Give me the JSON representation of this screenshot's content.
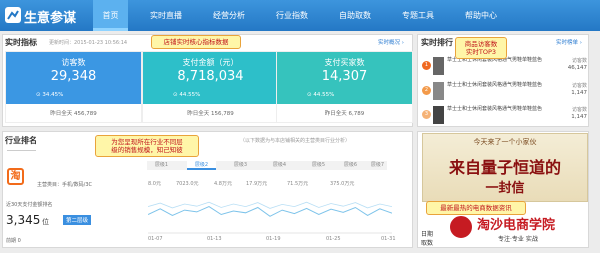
{
  "app": {
    "brand": "生意参谋"
  },
  "nav": {
    "items": [
      "首页",
      "实时直播",
      "经营分析",
      "行业指数",
      "自助取数",
      "专题工具",
      "帮助中心"
    ],
    "active_index": 0
  },
  "realtime": {
    "title": "实时指标",
    "update_time": "更新时间：2015-01-23 10:56:14",
    "link": "实时概况 ›",
    "cards": [
      {
        "label": "访客数",
        "value": "29,348",
        "change": "34.45%",
        "yesterday_label": "昨日全天",
        "yesterday_value": "456,789",
        "color": "#3b97e3"
      },
      {
        "label": "支付金额（元）",
        "value": "8,718,034",
        "change": "44.55%",
        "yesterday_label": "昨日全天",
        "yesterday_value": "156,789",
        "color": "#2dbfc9"
      },
      {
        "label": "支付买家数",
        "value": "14,307",
        "change": "44.55%",
        "yesterday_label": "昨日全天",
        "yesterday_value": "6,789",
        "color": "#36c3bd"
      }
    ]
  },
  "rank": {
    "title": "实时排行",
    "link": "实时榜单 ›",
    "items": [
      {
        "num": "1",
        "name": "草士士和士休闲套装风格通气男鞋单鞋蓝色",
        "unit": "访客数",
        "value": "46,147"
      },
      {
        "num": "2",
        "name": "草士士和士休闲套装风格通气男鞋单鞋蓝色",
        "unit": "访客数",
        "value": "1,147"
      },
      {
        "num": "3",
        "name": "草士士和士休闲套装风格通气男鞋单鞋蓝色",
        "unit": "访客数",
        "value": "1,147"
      }
    ]
  },
  "industry": {
    "title": "行业排名",
    "hint": "（以下数据为与本店铺相关的主营类目行业分析）",
    "shop_icon": "淘",
    "main_category": "主营类目：手机/数码/3C",
    "rank_label": "近30天支付金额排名",
    "rank_value": "3,345",
    "rank_unit": "位",
    "tier_badge": "第二层级",
    "prev_label": "前期 0",
    "tabs": [
      "层级1",
      "层级2",
      "层级3",
      "层级4",
      "层级5",
      "层级6",
      "层级7"
    ],
    "scales": [
      "8.0元",
      "7023.0元",
      "4.8万元",
      "17.9万元",
      "71.5万元",
      "375.0万元"
    ],
    "x_ticks": [
      "01-07",
      "01-13",
      "01-19",
      "01-25",
      "01-31"
    ]
  },
  "chart_data": {
    "type": "line",
    "x": [
      "01-07",
      "01-13",
      "01-19",
      "01-25",
      "01-31"
    ],
    "series": [
      {
        "values": [
          0.42,
          0.55,
          0.4,
          0.52,
          0.48,
          0.6,
          0.42,
          0.5,
          0.46,
          0.58,
          0.38,
          0.52,
          0.44,
          0.56,
          0.42,
          0.54,
          0.47,
          0.58,
          0.4,
          0.55,
          0.45
        ]
      },
      {
        "values": [
          0.6,
          0.68,
          0.57,
          0.66,
          0.61,
          0.7,
          0.58,
          0.66,
          0.6,
          0.69,
          0.56,
          0.65,
          0.6,
          0.7,
          0.58,
          0.67,
          0.61,
          0.69,
          0.57,
          0.66,
          0.6
        ]
      }
    ]
  },
  "ad": {
    "top": "今天来了一个小家伙",
    "line1": "来自量子恒道的",
    "line2": "一封信"
  },
  "bottom_labels": [
    "日期",
    "取数"
  ],
  "notes": [
    "店铺实时核心指标数据",
    "商品访客数\n实时TOP3",
    "为您呈现所在行业不同层\n级的销售规模，知己知彼",
    "最新最热的电商数据资讯"
  ],
  "watermark": {
    "title": "淘沙电商学院",
    "sub": "专注·专业 实战"
  },
  "colors": {
    "nav": "#2e86d3",
    "accent": "#2a7bd1",
    "note_text": "#c0141b"
  }
}
